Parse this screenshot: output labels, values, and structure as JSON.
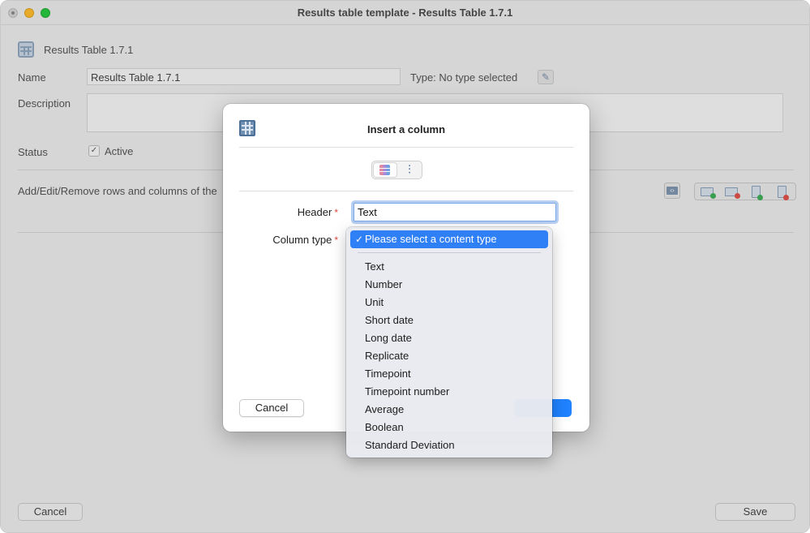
{
  "window": {
    "title": "Results table template - Results Table 1.7.1"
  },
  "header": {
    "app_name": "Results Table 1.7.1"
  },
  "form": {
    "name_label": "Name",
    "name_value": "Results Table 1.7.1",
    "type_label": "Type: No type selected",
    "description_label": "Description",
    "description_value": "",
    "status_label": "Status",
    "active_label": "Active",
    "active_check": "✓",
    "instruction_text": "Add/Edit/Remove rows and columns of the"
  },
  "footer": {
    "cancel_label": "Cancel",
    "save_label": "Save"
  },
  "dialog": {
    "title": "Insert a column",
    "header_label": "Header",
    "header_value": "Text",
    "column_type_label": "Column type",
    "required_mark": "*",
    "cancel_label": "Cancel",
    "ok_label": ""
  },
  "dropdown": {
    "check": "✓",
    "selected": "Please select a content type",
    "options": [
      "Text",
      "Number",
      "Unit",
      "Short date",
      "Long date",
      "Replicate",
      "Timepoint",
      "Timepoint number",
      "Average",
      "Boolean",
      "Standard Deviation"
    ]
  },
  "colors": {
    "accent": "#1f82ff",
    "selection": "#2f7ff7",
    "required": "#e0483e"
  },
  "icons": {
    "app": "table-grid-icon",
    "edit": "pencil-edit-icon",
    "segment_a": "table-columns-icon",
    "segment_b": "sliders-icon",
    "toolbar": [
      "code-icon",
      "add-row-icon",
      "remove-row-icon",
      "add-column-icon",
      "remove-column-icon"
    ]
  }
}
